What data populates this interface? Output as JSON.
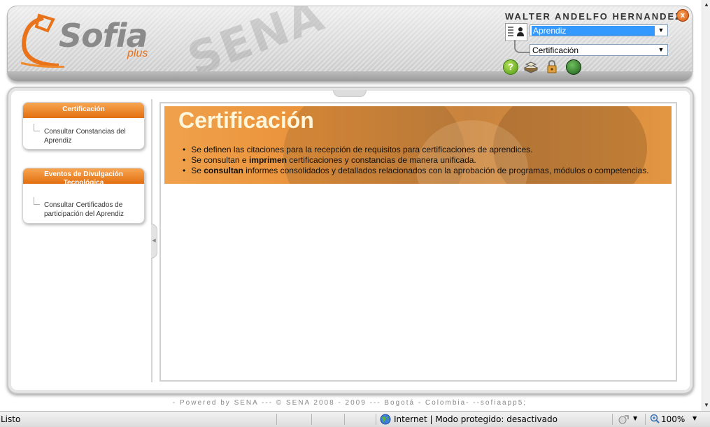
{
  "header": {
    "logo_text": "Sofia",
    "logo_sub": "plus",
    "watermark": "SENA",
    "user_name": "WALTER ANDELFO HERNANDEZ",
    "close_label": "x",
    "role_select": {
      "value": "Aprendiz"
    },
    "module_select": {
      "value": "Certificación"
    },
    "icons": [
      "help-icon",
      "books-icon",
      "lock-icon",
      "power-icon"
    ]
  },
  "sidebar": {
    "menus": [
      {
        "title": "Certificación",
        "items": [
          {
            "label": "Consultar Constancias del Aprendiz"
          }
        ]
      },
      {
        "title": "Eventos de Divulgación Tecnológica",
        "items": [
          {
            "label": "Consultar Certificados de participación del Aprendiz"
          }
        ]
      }
    ]
  },
  "banner": {
    "title": "Certificación",
    "bullets": [
      {
        "pre": "Se definen las citaciones para la recepción de requisitos para certificaciones de aprendices.",
        "bold": "",
        "post": ""
      },
      {
        "pre": "Se consultan e ",
        "bold": "imprimen",
        "post": " certificaciones y constancias de manera unificada."
      },
      {
        "pre": "Se ",
        "bold": "consultan",
        "post": " informes consolidados y detallados relacionados con la aprobación de programas, módulos o competencias."
      }
    ]
  },
  "footer": {
    "text": "- Powered by SENA --- © SENA 2008 - 2009 --- Bogotá - Colombia- --sofiaapp5;"
  },
  "statusbar": {
    "status": "Listo",
    "zone": "Internet | Modo protegido: desactivado",
    "zoom": "100%"
  },
  "colors": {
    "accent": "#e8731a",
    "banner": "#ec9a42",
    "panel_border": "#c7c7c7"
  }
}
